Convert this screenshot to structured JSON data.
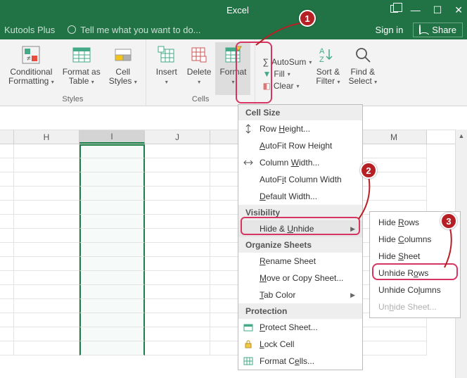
{
  "titlebar": {
    "app": "Excel"
  },
  "secondbar": {
    "tab_kutools": "Kutools Plus",
    "tell_me": "Tell me what you want to do...",
    "sign_in": "Sign in",
    "share": "Share"
  },
  "ribbon": {
    "styles": {
      "conditional": "Conditional\nFormatting",
      "format_table": "Format as\nTable",
      "cell_styles": "Cell\nStyles",
      "group_label": "Styles"
    },
    "cells": {
      "insert": "Insert",
      "delete": "Delete",
      "format": "Format",
      "group_label": "Cells"
    },
    "editing": {
      "autosum": "AutoSum",
      "fill": "Fill",
      "clear": "Clear",
      "sort": "Sort &\nFilter",
      "find": "Find &\nSelect"
    }
  },
  "columns": [
    "H",
    "I",
    "J",
    "M"
  ],
  "format_menu": {
    "cell_size": "Cell Size",
    "row_height": "Row Height...",
    "autofit_row": "AutoFit Row Height",
    "col_width": "Column Width...",
    "autofit_col": "AutoFit Column Width",
    "default_width": "Default Width...",
    "visibility": "Visibility",
    "hide_unhide": "Hide & Unhide",
    "organize": "Organize Sheets",
    "rename": "Rename Sheet",
    "move_copy": "Move or Copy Sheet...",
    "tab_color": "Tab Color",
    "protection": "Protection",
    "protect_sheet": "Protect Sheet...",
    "lock_cell": "Lock Cell",
    "format_cells": "Format Cells..."
  },
  "submenu": {
    "hide_rows": "Hide Rows",
    "hide_cols": "Hide Columns",
    "hide_sheet": "Hide Sheet",
    "unhide_rows": "Unhide Rows",
    "unhide_cols": "Unhide Columns",
    "unhide_sheet": "Unhide Sheet..."
  },
  "callouts": {
    "c1": "1",
    "c2": "2",
    "c3": "3"
  }
}
